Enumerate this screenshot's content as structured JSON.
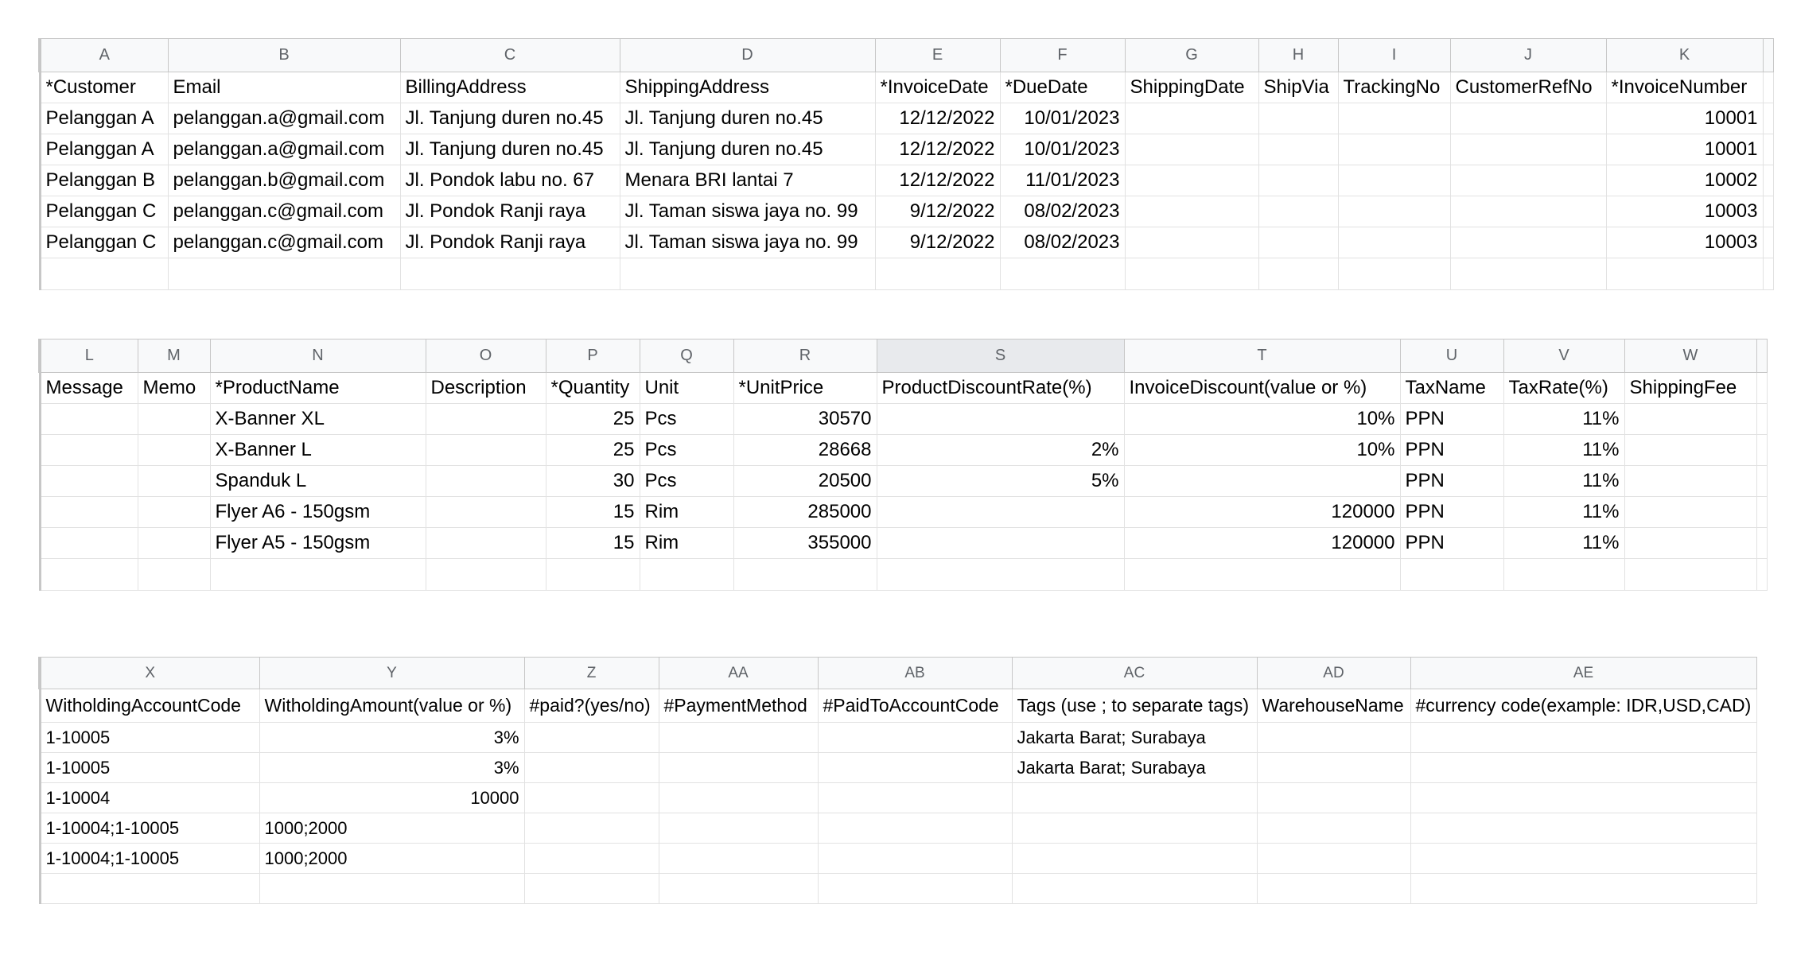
{
  "table1": {
    "columns": [
      "A",
      "B",
      "C",
      "D",
      "E",
      "F",
      "G",
      "H",
      "I",
      "J",
      "K"
    ],
    "headers": [
      "*Customer",
      "Email",
      "BillingAddress",
      "ShippingAddress",
      "*InvoiceDate",
      "*DueDate",
      "ShippingDate",
      "ShipVia",
      "TrackingNo",
      "CustomerRefNo",
      "*InvoiceNumber"
    ],
    "rows": [
      [
        "Pelanggan A",
        "pelanggan.a@gmail.com",
        "Jl. Tanjung duren no.45",
        "Jl. Tanjung duren no.45",
        "12/12/2022",
        "10/01/2023",
        "",
        "",
        "",
        "",
        "10001"
      ],
      [
        "Pelanggan A",
        "pelanggan.a@gmail.com",
        "Jl. Tanjung duren no.45",
        "Jl. Tanjung duren no.45",
        "12/12/2022",
        "10/01/2023",
        "",
        "",
        "",
        "",
        "10001"
      ],
      [
        "Pelanggan B",
        "pelanggan.b@gmail.com",
        "Jl. Pondok labu no. 67",
        "Menara BRI lantai 7",
        "12/12/2022",
        "11/01/2023",
        "",
        "",
        "",
        "",
        "10002"
      ],
      [
        "Pelanggan C",
        "pelanggan.c@gmail.com",
        "Jl. Pondok Ranji raya",
        "Jl. Taman siswa jaya no. 99",
        "9/12/2022",
        "08/02/2023",
        "",
        "",
        "",
        "",
        "10003"
      ],
      [
        "Pelanggan C",
        "pelanggan.c@gmail.com",
        "Jl. Pondok Ranji raya",
        "Jl. Taman siswa jaya no. 99",
        "9/12/2022",
        "08/02/2023",
        "",
        "",
        "",
        "",
        "10003"
      ]
    ]
  },
  "table2": {
    "columns": [
      "L",
      "M",
      "N",
      "O",
      "P",
      "Q",
      "R",
      "S",
      "T",
      "U",
      "V",
      "W"
    ],
    "selected_column": "S",
    "headers": [
      "Message",
      "Memo",
      "*ProductName",
      "Description",
      "*Quantity",
      "Unit",
      "*UnitPrice",
      "ProductDiscountRate(%)",
      "InvoiceDiscount(value or %)",
      "TaxName",
      "TaxRate(%)",
      "ShippingFee"
    ],
    "rows": [
      [
        "",
        "",
        "X-Banner XL",
        "",
        "25",
        "Pcs",
        "30570",
        "",
        "10%",
        "PPN",
        "11%",
        ""
      ],
      [
        "",
        "",
        "X-Banner L",
        "",
        "25",
        "Pcs",
        "28668",
        "2%",
        "10%",
        "PPN",
        "11%",
        ""
      ],
      [
        "",
        "",
        "Spanduk L",
        "",
        "30",
        "Pcs",
        "20500",
        "5%",
        "",
        "PPN",
        "11%",
        ""
      ],
      [
        "",
        "",
        "Flyer A6 - 150gsm",
        "",
        "15",
        "Rim",
        "285000",
        "",
        "120000",
        "PPN",
        "11%",
        ""
      ],
      [
        "",
        "",
        "Flyer A5 - 150gsm",
        "",
        "15",
        "Rim",
        "355000",
        "",
        "120000",
        "PPN",
        "11%",
        ""
      ]
    ]
  },
  "table3": {
    "columns": [
      "X",
      "Y",
      "Z",
      "AA",
      "AB",
      "AC",
      "AD",
      "AE"
    ],
    "headers": [
      "WitholdingAccountCode",
      "WitholdingAmount(value or %)",
      "#paid?(yes/no)",
      "#PaymentMethod",
      "#PaidToAccountCode",
      "Tags (use ; to separate tags)",
      "WarehouseName",
      "#currency code(example: IDR,USD,CAD)"
    ],
    "rows": [
      [
        "1-10005",
        "3%",
        "",
        "",
        "",
        "Jakarta Barat; Surabaya",
        "",
        ""
      ],
      [
        "1-10005",
        "3%",
        "",
        "",
        "",
        "Jakarta Barat; Surabaya",
        "",
        ""
      ],
      [
        "1-10004",
        "10000",
        "",
        "",
        "",
        "",
        "",
        ""
      ],
      [
        "1-10004;1-10005",
        "1000;2000",
        "",
        "",
        "",
        "",
        "",
        ""
      ],
      [
        "1-10004;1-10005",
        "1000;2000",
        "",
        "",
        "",
        "",
        "",
        ""
      ]
    ]
  }
}
